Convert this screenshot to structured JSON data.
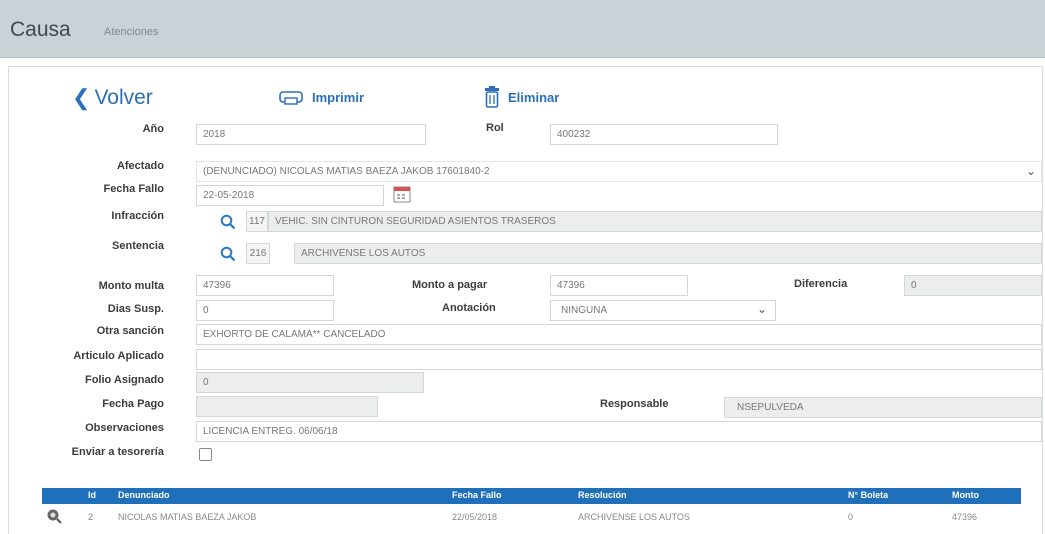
{
  "header": {
    "title": "Causa",
    "subtitle": "Atenciones"
  },
  "toolbar": {
    "back_label": "Volver",
    "print_label": "Imprimir",
    "delete_label": "Eliminar"
  },
  "form": {
    "anio": {
      "label": "Año",
      "value": "2018"
    },
    "rol": {
      "label": "Rol",
      "value": "400232"
    },
    "afectado": {
      "label": "Afectado",
      "value": "(DENUNCIADO) NICOLAS MATIAS BAEZA JAKOB 17601840-2"
    },
    "fecha_fallo": {
      "label": "Fecha Fallo",
      "value": "22-05-2018"
    },
    "infraccion": {
      "label": "Infracción",
      "code": "117",
      "value": "VEHIC. SIN CINTURON SEGURIDAD ASIENTOS TRASEROS"
    },
    "sentencia": {
      "label": "Sentencia",
      "code": "216",
      "value": "ARCHIVENSE LOS AUTOS"
    },
    "monto_multa": {
      "label": "Monto multa",
      "value": "47396"
    },
    "monto_pagar": {
      "label": "Monto a pagar",
      "value": "47396"
    },
    "diferencia": {
      "label": "Diferencia",
      "value": "0"
    },
    "dias_susp": {
      "label": "Dias Susp.",
      "value": "0"
    },
    "anotacion": {
      "label": "Anotación",
      "value": "NINGUNA"
    },
    "otra_sancion": {
      "label": "Otra sanción",
      "value": "EXHORTO DE CALAMA** CANCELADO"
    },
    "articulo": {
      "label": "Articulo Aplicado",
      "value": ""
    },
    "folio": {
      "label": "Folio Asignado",
      "value": "0"
    },
    "fecha_pago": {
      "label": "Fecha Pago",
      "value": ""
    },
    "responsable": {
      "label": "Responsable",
      "value": "NSEPULVEDA"
    },
    "observaciones": {
      "label": "Observaciones",
      "value": "LICENCIA ENTREG. 06/06/18"
    },
    "enviar_tesoreria": {
      "label": "Enviar a tesorería",
      "checked": false
    }
  },
  "grid": {
    "columns": [
      "Id",
      "Denunciado",
      "Fecha Fallo",
      "Resolución",
      "N° Boleta",
      "Monto"
    ],
    "rows": [
      {
        "id": "2",
        "denunciado": "NICOLAS MATIAS BAEZA JAKOB",
        "fecha_fallo": "22/05/2018",
        "resolucion": "ARCHIVENSE LOS AUTOS",
        "boleta": "0",
        "monto": "47396",
        "icon": "view-icon"
      }
    ]
  },
  "colors": {
    "accent": "#2b6fb5",
    "header_bg": "#c9d2d6",
    "grid_head": "#1f6fba"
  }
}
